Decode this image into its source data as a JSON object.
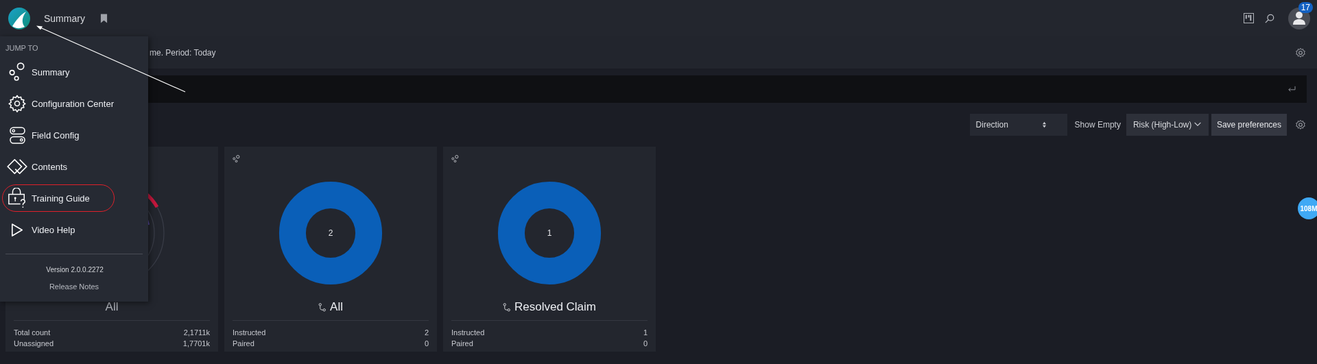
{
  "top_bar": {
    "title": "Summary",
    "notification_count": "17"
  },
  "subheader": {
    "text": "me. Period: Today"
  },
  "toolbar": {
    "direction": "Direction",
    "show_empty": "Show Empty",
    "sort": "Risk (High-Low)",
    "save": "Save preferences"
  },
  "floating_badge": "108M",
  "cards": [
    {
      "kind": "gauge",
      "title": "All",
      "title_icon": false,
      "stats": [
        {
          "label": "Total count",
          "value": "2,1711k"
        },
        {
          "label": "Unassigned",
          "value": "1,7701k"
        }
      ]
    },
    {
      "kind": "donut",
      "title": "All",
      "title_icon": true,
      "center_value": "2",
      "stats": [
        {
          "label": "Instructed",
          "value": "2"
        },
        {
          "label": "Paired",
          "value": "0"
        }
      ]
    },
    {
      "kind": "donut",
      "title": "Resolved Claim",
      "title_icon": true,
      "center_value": "1",
      "stats": [
        {
          "label": "Instructed",
          "value": "1"
        },
        {
          "label": "Paired",
          "value": "0"
        }
      ]
    }
  ],
  "menu": {
    "heading": "JUMP TO",
    "items": [
      {
        "label": "Summary",
        "highlighted": false
      },
      {
        "label": "Configuration Center",
        "highlighted": false
      },
      {
        "label": "Field Config",
        "highlighted": false
      },
      {
        "label": "Contents",
        "highlighted": false
      },
      {
        "label": "Training Guide",
        "highlighted": true
      },
      {
        "label": "Video Help",
        "highlighted": false
      }
    ],
    "version": "Version 2.0.0.2272",
    "release_notes": "Release Notes"
  }
}
